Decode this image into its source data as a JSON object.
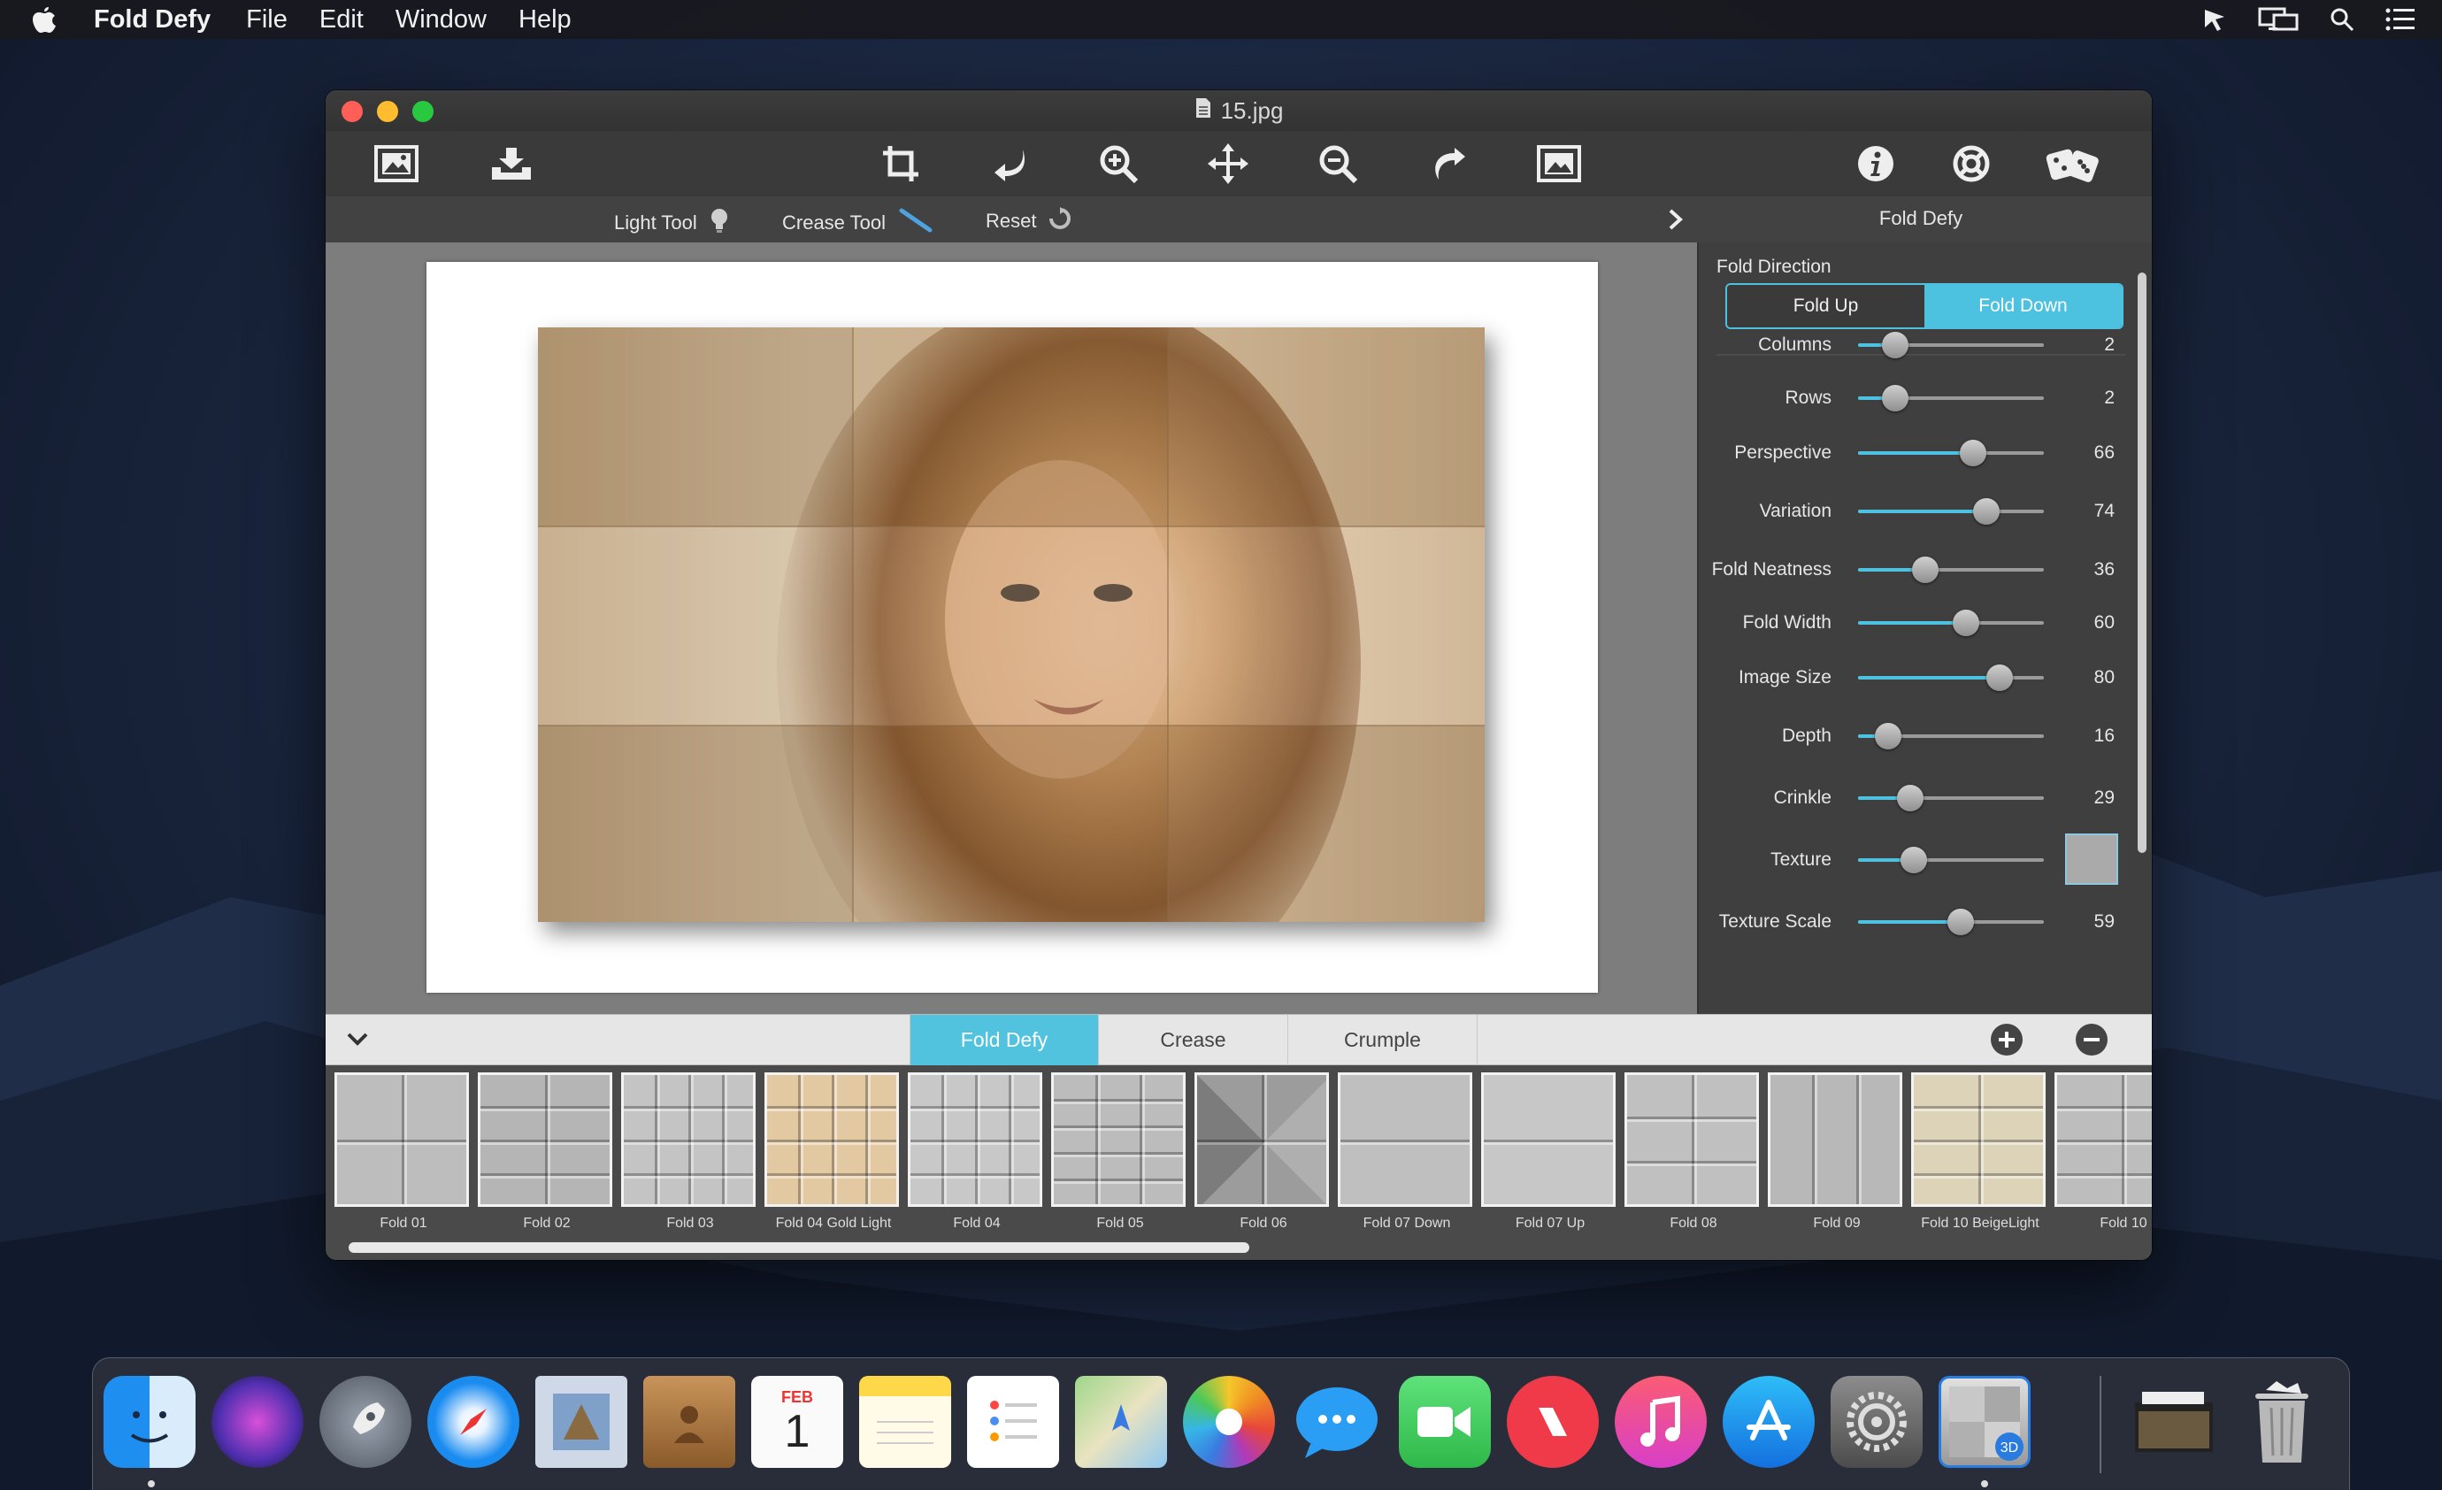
{
  "menubar": {
    "app_name": "Fold Defy",
    "items": [
      "File",
      "Edit",
      "Window",
      "Help"
    ]
  },
  "window": {
    "title": "15.jpg"
  },
  "subbar": {
    "light_tool": "Light Tool",
    "crease_tool": "Crease Tool",
    "reset": "Reset",
    "panel_title": "Fold Defy"
  },
  "panel": {
    "fold_direction_label": "Fold Direction",
    "fold_up": "Fold Up",
    "fold_down": "Fold Down",
    "selected_direction": "Fold Down",
    "sliders": [
      {
        "label": "Columns",
        "value": "2",
        "fraction": 0.2
      },
      {
        "label": "Rows",
        "value": "2",
        "fraction": 0.2
      },
      {
        "label": "Perspective",
        "value": "66",
        "fraction": 0.62
      },
      {
        "label": "Variation",
        "value": "74",
        "fraction": 0.69
      },
      {
        "label": "Fold Neatness",
        "value": "36",
        "fraction": 0.36
      },
      {
        "label": "Fold Width",
        "value": "60",
        "fraction": 0.58
      },
      {
        "label": "Image Size",
        "value": "80",
        "fraction": 0.76
      },
      {
        "label": "Depth",
        "value": "16",
        "fraction": 0.16
      },
      {
        "label": "Crinkle",
        "value": "29",
        "fraction": 0.28
      },
      {
        "label": "Texture",
        "value": "",
        "fraction": 0.3,
        "swatch": true
      },
      {
        "label": "Texture Scale",
        "value": "59",
        "fraction": 0.55
      }
    ]
  },
  "tabs": {
    "items": [
      "Fold Defy",
      "Crease",
      "Crumple"
    ],
    "active": "Fold Defy"
  },
  "presets": [
    {
      "label": "Fold 01",
      "pattern": "grid2x2",
      "tint": "#bdbdbd"
    },
    {
      "label": "Fold 02",
      "pattern": "rows4",
      "tint": "#b5b5b5"
    },
    {
      "label": "Fold 03",
      "pattern": "grid4x4",
      "tint": "#c4c4c4"
    },
    {
      "label": "Fold 04 Gold Light",
      "pattern": "grid4x4",
      "tint": "#e3c9a2"
    },
    {
      "label": "Fold 04",
      "pattern": "grid4x4",
      "tint": "#c8c8c8"
    },
    {
      "label": "Fold 05",
      "pattern": "brick",
      "tint": "#bcbcbc"
    },
    {
      "label": "Fold 06",
      "pattern": "quad",
      "tint": "#9c9c9c"
    },
    {
      "label": "Fold 07 Down",
      "pattern": "rows2",
      "tint": "#bfbfbf"
    },
    {
      "label": "Fold 07 Up",
      "pattern": "rows2",
      "tint": "#c7c7c7"
    },
    {
      "label": "Fold 08",
      "pattern": "grid2x3",
      "tint": "#c0c0c0"
    },
    {
      "label": "Fold 09",
      "pattern": "cols3",
      "tint": "#b8b8b8"
    },
    {
      "label": "Fold 10 BeigeLight",
      "pattern": "rows4",
      "tint": "#dcd3b8"
    },
    {
      "label": "Fold 10",
      "pattern": "rows4",
      "tint": "#bdbdbd"
    }
  ],
  "dock": {
    "calendar_month": "FEB",
    "calendar_day": "1"
  },
  "colors": {
    "accent": "#4dc2e0",
    "tab_active": "#52c3de"
  }
}
